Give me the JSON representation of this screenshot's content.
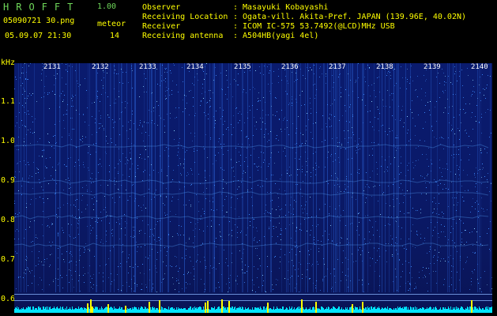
{
  "header": {
    "app_title": "HROFFT",
    "version": "1.00",
    "filename": "05090721 30.png",
    "datetime": "05.09.07 21:30",
    "meteor_label": "meteor",
    "meteor_count": "14"
  },
  "station": [
    {
      "label": "Observer",
      "value": ": Masayuki Kobayashi"
    },
    {
      "label": "Receiving Location",
      "value": ": Ogata-vill. Akita-Pref. JAPAN (139.96E, 40.02N)"
    },
    {
      "label": "Receiver",
      "value": ": ICOM IC-575 53.7492(@LCD)MHz USB"
    },
    {
      "label": "Receiving antenna",
      "value": ": A504HB(yagi 4el)"
    }
  ],
  "spectrogram": {
    "y_axis_label": "kHz",
    "y_ticks": [
      "1.1",
      "1.0",
      "0.9",
      "0.8",
      "0.7",
      "0.6"
    ],
    "time_ticks": [
      "2131",
      "2132",
      "2133",
      "2134",
      "2135",
      "2136",
      "2137",
      "2138",
      "2139",
      "2140"
    ],
    "colors": {
      "background": "#000000",
      "spectrum_base": "#0a1a6a",
      "noise": "#3d8bff",
      "signal": "#ffff00",
      "text_yellow": "#ffff00",
      "text_green": "#6fd85a"
    }
  }
}
